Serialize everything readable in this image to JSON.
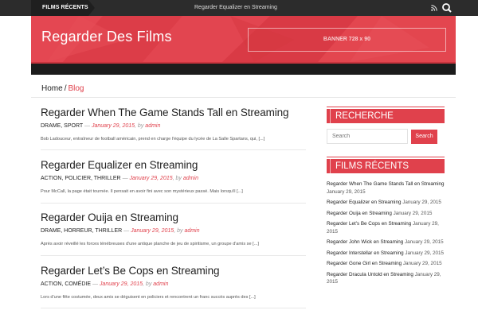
{
  "topbar": {
    "tag_label": "FILMS RÉCENTS",
    "ticker": "Regarder Equalizer en Streaming",
    "rss_icon": "rss-icon",
    "search_icon": "search-icon"
  },
  "header": {
    "site_title": "Regarder Des Films",
    "banner_label": "BANNER 728 x 90"
  },
  "breadcrumb": {
    "home": "Home",
    "separator": "/",
    "current": "Blog"
  },
  "posts": [
    {
      "title": "Regarder When The Game Stands Tall en Streaming",
      "categories": "DRAME, SPORT",
      "date": "January 29, 2015",
      "by": ", by",
      "author": "admin",
      "excerpt": "Bob Ladouceur, entraîneur de football américain, prend en charge l'équipe du lycée de La Salle Spartans, qui, [...]"
    },
    {
      "title": "Regarder Equalizer en Streaming",
      "categories": "ACTION, POLICIER, THRILLER",
      "date": "January 29, 2015",
      "by": ", by",
      "author": "admin",
      "excerpt": "Pour McCall, la page était tournée. Il pensait en avoir fini avec son mystérieux passé. Mais lorsqu'il [...]"
    },
    {
      "title": "Regarder Ouija en Streaming",
      "categories": "DRAME, HORREUR, THRILLER",
      "date": "January 29, 2015",
      "by": ", by",
      "author": "admin",
      "excerpt": "Après avoir réveillé les forces ténébreuses d'une antique planche de jeu de spiritisme, un groupe d'amis se [...]"
    },
    {
      "title": "Regarder Let’s Be Cops en Streaming",
      "categories": "ACTION, COMÉDIE",
      "date": "January 29, 2015",
      "by": ", by",
      "author": "admin",
      "excerpt": "Lors d'une fête costumée, deux amis se déguisent en policiers et rencontrent un franc succès auprès des [...]"
    }
  ],
  "sidebar": {
    "search_title": "RECHERCHE",
    "search_placeholder": "Search",
    "search_button": "Search",
    "recent_title": "FILMS RÉCENTS",
    "recent": [
      {
        "title": "Regarder When The Game Stands Tall en Streaming",
        "date": "January 29, 2015"
      },
      {
        "title": "Regarder Equalizer en Streaming",
        "date": "January 29, 2015"
      },
      {
        "title": "Regarder Ouija en Streaming",
        "date": "January 29, 2015"
      },
      {
        "title": "Regarder Let's Be Cops en Streaming",
        "date": "January 29, 2015"
      },
      {
        "title": "Regarder John Wick en Streaming",
        "date": "January 29, 2015"
      },
      {
        "title": "Regarder Interstellar en Streaming",
        "date": "January 29, 2015"
      },
      {
        "title": "Regarder Gone Girl en Streaming",
        "date": "January 29, 2015"
      },
      {
        "title": "Regarder Dracula Untold en Streaming",
        "date": "January 29, 2015"
      }
    ]
  },
  "colors": {
    "accent": "#e0414c",
    "topbar": "#2c2c2c",
    "navstrip": "#1c1c1c"
  }
}
